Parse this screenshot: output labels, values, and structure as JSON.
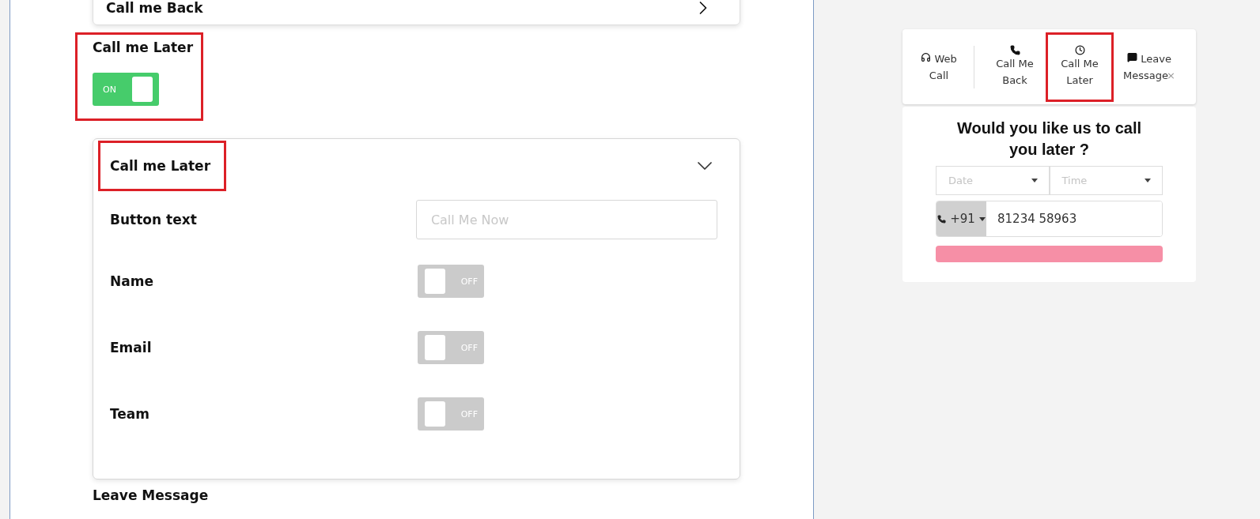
{
  "settings": {
    "collapsed_section": {
      "title": "Call me Back",
      "expanded": false
    },
    "section": {
      "title": "Call me Later",
      "highlighted": true,
      "toggle": {
        "label": "ON",
        "on": true
      }
    },
    "panel": {
      "title": "Call me Later",
      "highlighted": true,
      "expanded": true,
      "fields": [
        {
          "kind": "text",
          "label": "Button text",
          "placeholder": "Call Me Now"
        },
        {
          "kind": "toggle",
          "label": "Name",
          "on": false,
          "toggle_label": "OFF"
        },
        {
          "kind": "toggle",
          "label": "Email",
          "on": false,
          "toggle_label": "OFF"
        },
        {
          "kind": "toggle",
          "label": "Team",
          "on": false,
          "toggle_label": "OFF"
        }
      ]
    },
    "next_section": {
      "title": "Leave Message"
    }
  },
  "preview": {
    "tabs": [
      {
        "label": "Web Call",
        "kind": "inline",
        "highlighted": false
      },
      {
        "label": "Call Me Back",
        "kind": "stacked",
        "highlighted": false
      },
      {
        "label": "Call Me Later",
        "kind": "stacked",
        "highlighted": true
      },
      {
        "label": "Leave Message",
        "kind": "inline",
        "highlighted": false,
        "close": "×"
      }
    ],
    "form": {
      "heading": "Would you like us to call you later ?",
      "date": {
        "placeholder": "Date"
      },
      "time": {
        "placeholder": "Time"
      },
      "phone": {
        "code": "+91",
        "value": "81234 58963"
      }
    }
  }
}
